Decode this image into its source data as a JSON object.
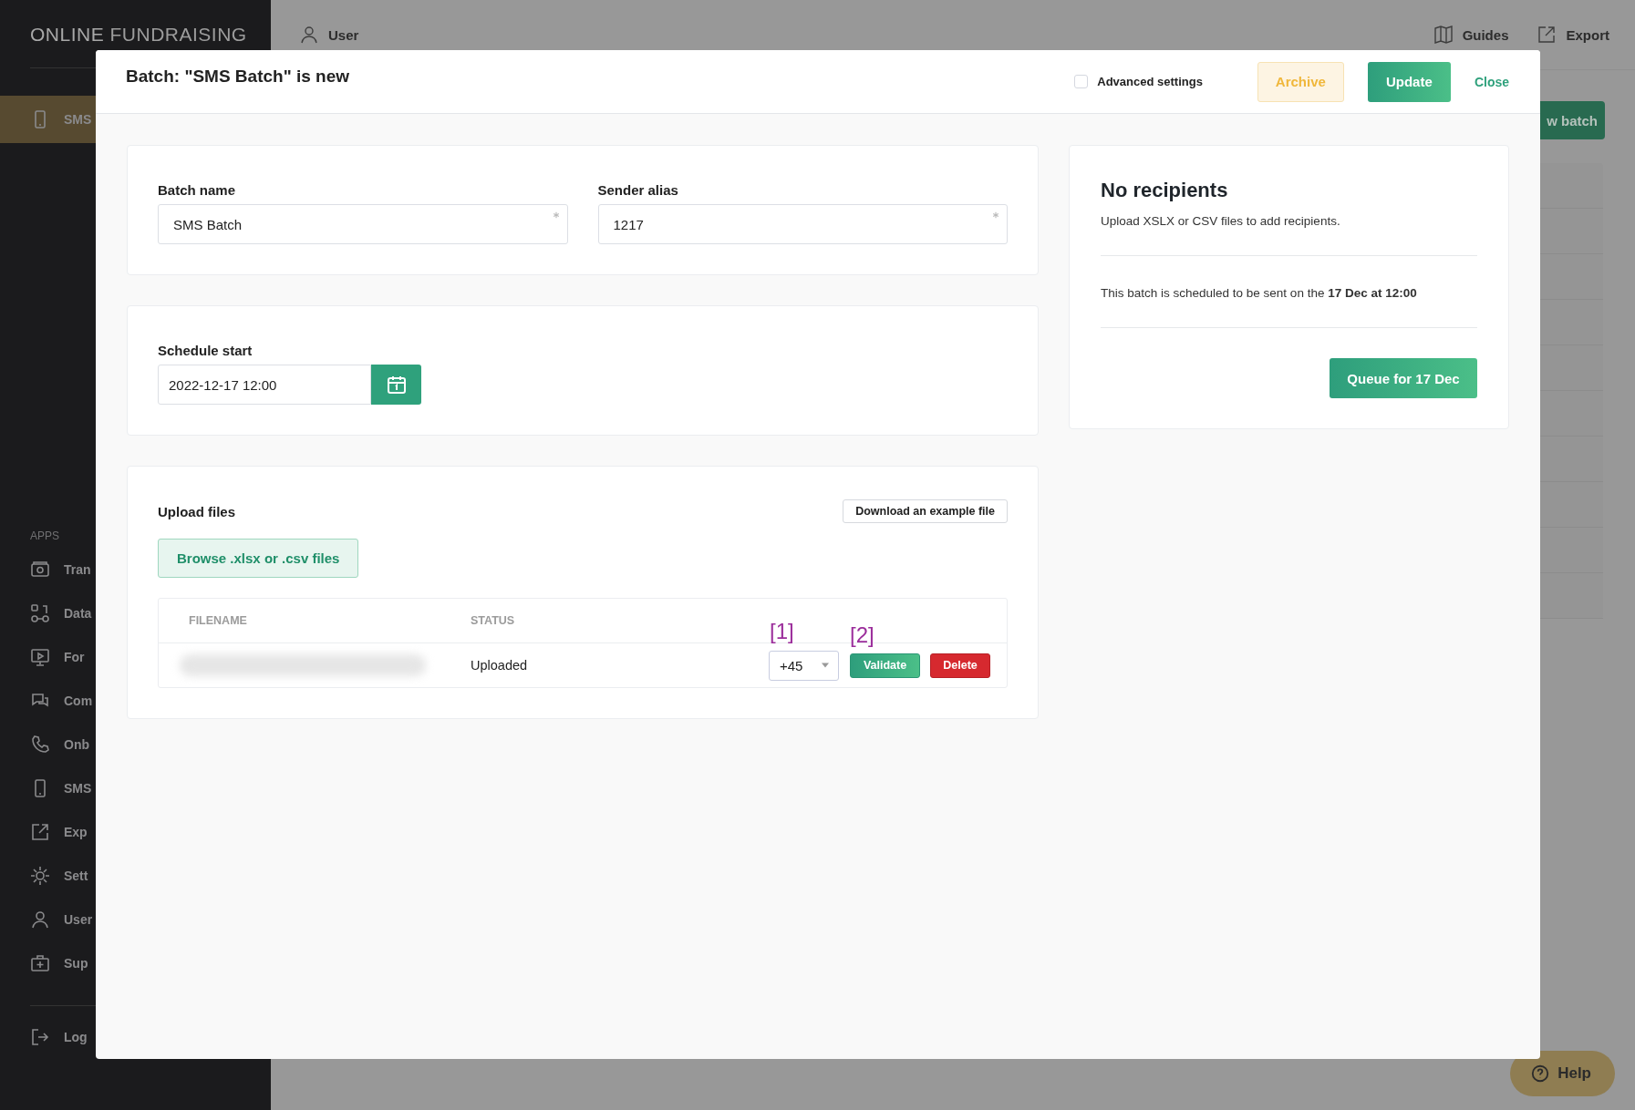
{
  "sidebar": {
    "logo": "**ONLINE** FUNDRAISING",
    "top_items": [
      {
        "label": "SMS",
        "selected": true
      }
    ],
    "section_title": "APPS",
    "items": [
      {
        "label": "Tran",
        "selected": false
      },
      {
        "label": "Data",
        "selected": false
      },
      {
        "label": "For",
        "selected": false
      },
      {
        "label": "Com",
        "selected": false
      },
      {
        "label": "Onb",
        "selected": false
      },
      {
        "label": "SMS",
        "selected": false
      },
      {
        "label": "Exp",
        "selected": false
      },
      {
        "label": "Sett",
        "selected": false
      },
      {
        "label": "User",
        "selected": false
      },
      {
        "label": "Sup",
        "selected": false
      }
    ],
    "logout": "Log"
  },
  "topbar": {
    "user": "User",
    "links": [
      "Guides",
      "Export"
    ]
  },
  "page_button": "w batch",
  "help_button": "Help",
  "modal": {
    "title": "Batch: \"SMS Batch\" is new",
    "advanced_settings": {
      "label": "Advanced settings",
      "checked": false
    },
    "actions": {
      "archive": "Archive",
      "update": "Update",
      "close": "Close"
    },
    "fields": [
      {
        "label": "Batch name",
        "value": "SMS Batch",
        "required": true
      },
      {
        "label": "Sender alias",
        "value": "1217",
        "required": true
      }
    ],
    "schedule": {
      "label": "Schedule start",
      "value": "2022-12-17 12:00"
    },
    "upload": {
      "title": "Upload files",
      "example_button": "Download an example file",
      "browse_button": "Browse .xlsx or .csv files",
      "columns": [
        "FILENAME",
        "STATUS"
      ],
      "rows": [
        {
          "filename_redacted": true,
          "status": "Uploaded",
          "country_code": "+45",
          "validate": "Validate",
          "delete": "Delete",
          "annotations": [
            "[1]",
            "[2]"
          ]
        }
      ]
    },
    "summary": {
      "title": "No recipients",
      "text": "Upload XSLX or CSV files to add recipients.",
      "schedule_note": "This batch is scheduled to be sent on the **17 Dec at 12:00**",
      "queue_button": "Queue for 17 Dec"
    }
  }
}
